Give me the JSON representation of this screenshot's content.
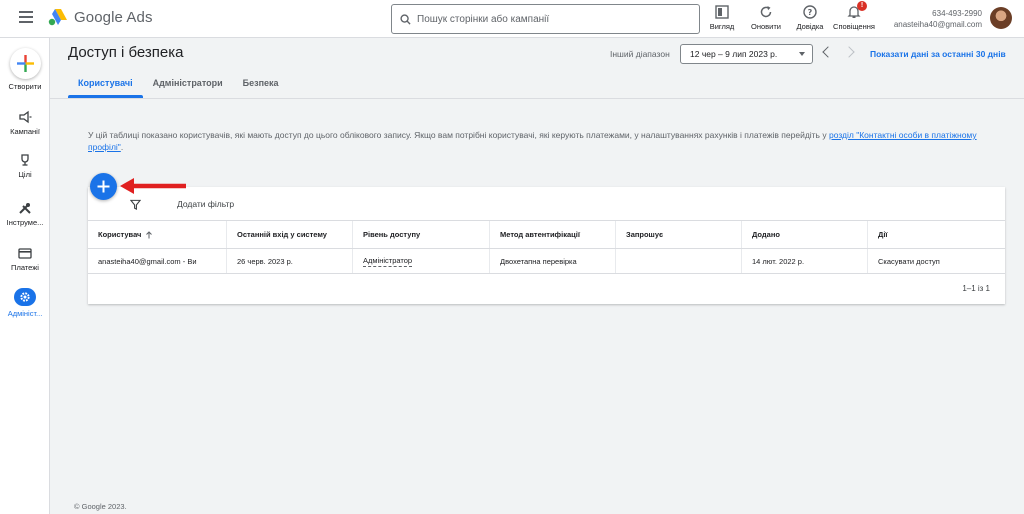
{
  "header": {
    "logo_text": "Google Ads",
    "search_placeholder": "Пошук сторінки або кампанії",
    "actions": [
      {
        "icon": "view-icon",
        "label": "Вигляд"
      },
      {
        "icon": "refresh-icon",
        "label": "Оновити"
      },
      {
        "icon": "help-icon",
        "label": "Довідка"
      },
      {
        "icon": "bell-icon",
        "label": "Сповіщення"
      }
    ],
    "notification_badge": "!",
    "account_id": "634-493-2990",
    "account_email": "anasteiha40@gmail.com"
  },
  "leftnav": {
    "create_label": "Створити",
    "items": [
      {
        "icon": "megaphone-icon",
        "label": "Кампанії"
      },
      {
        "icon": "trophy-icon",
        "label": "Цілі"
      },
      {
        "icon": "tools-icon",
        "label": "Інструме..."
      },
      {
        "icon": "card-icon",
        "label": "Платежі"
      },
      {
        "icon": "gear-icon",
        "label": "Адмініст..."
      }
    ]
  },
  "page": {
    "title": "Доступ і безпека",
    "range_label": "Інший діапазон",
    "range_value": "12 чер – 9 лип 2023 р.",
    "show_link": "Показати дані за останні 30 днів"
  },
  "tabs": [
    "Користувачі",
    "Адміністратори",
    "Безпека"
  ],
  "info": {
    "text": "У цій таблиці показано користувачів, які мають доступ до цього облікового запису. Якщо вам потрібні користувачі, які керують платежами, у налаштуваннях рахунків і платежів перейдіть у ",
    "link": "розділ \"Контактні особи в платіжному профілі\"",
    "end": "."
  },
  "table": {
    "filter_label": "Додати фільтр",
    "columns": [
      "Користувач",
      "Останній вхід у систему",
      "Рівень доступу",
      "Метод автентифікації",
      "Запрошує",
      "Додано",
      "Дії"
    ],
    "rows": [
      [
        "anasteiha40@gmail.com - Ви",
        "26 черв. 2023 р.",
        "Адміністратор",
        "Двохетапна перевірка",
        "",
        "14 лют. 2022 р.",
        "Скасувати доступ"
      ]
    ],
    "pagination": "1–1 із 1"
  },
  "footer": "© Google 2023.",
  "colors": {
    "accent": "#1a73e8",
    "arrow": "#e02020"
  }
}
